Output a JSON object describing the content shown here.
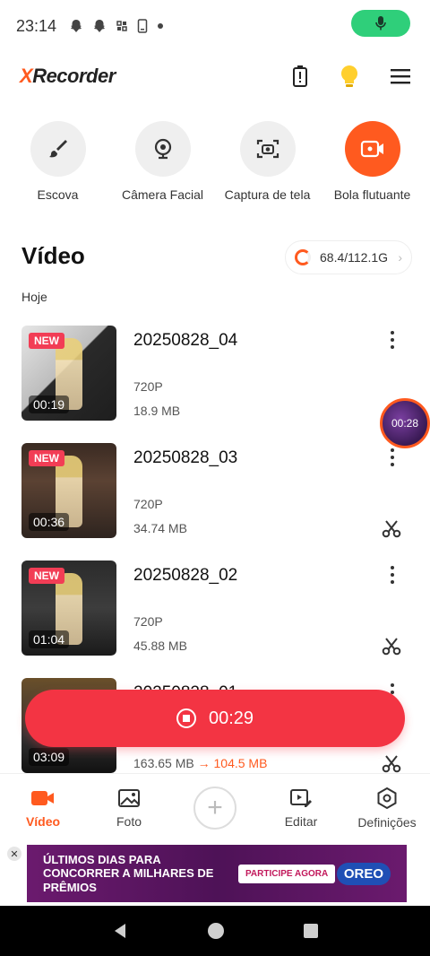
{
  "status_bar": {
    "time": "23:14"
  },
  "header": {
    "app_name_accent": "X",
    "app_name_rest": "Recorder"
  },
  "tools": [
    {
      "label": "Escova",
      "icon": "brush-icon"
    },
    {
      "label": "Câmera Facial",
      "icon": "webcam-icon"
    },
    {
      "label": "Captura de tela",
      "icon": "screenshot-icon"
    },
    {
      "label": "Bola flutuante",
      "icon": "float-video-icon"
    }
  ],
  "section": {
    "title": "Vídeo",
    "storage": "68.4/112.1G",
    "date_group": "Hoje"
  },
  "videos": [
    {
      "name": "20250828_04",
      "badge": "NEW",
      "duration": "00:19",
      "resolution": "720P",
      "size": "18.9 MB"
    },
    {
      "name": "20250828_03",
      "badge": "NEW",
      "duration": "00:36",
      "resolution": "720P",
      "size": "34.74 MB"
    },
    {
      "name": "20250828_02",
      "badge": "NEW",
      "duration": "01:04",
      "resolution": "720P",
      "size": "45.88 MB"
    },
    {
      "name": "20250828_01",
      "duration": "03:09",
      "size_original": "163.65 MB",
      "size_arrow": "→",
      "size_compressed": "104.5 MB"
    }
  ],
  "floating_ball": {
    "time": "00:28"
  },
  "record_button": {
    "elapsed": "00:29"
  },
  "bottom_nav": [
    {
      "label": "Vídeo",
      "icon": "video-icon",
      "active": true
    },
    {
      "label": "Foto",
      "icon": "photo-icon",
      "active": false
    },
    {
      "label": "+",
      "icon": "plus-icon"
    },
    {
      "label": "Editar",
      "icon": "edit-icon",
      "active": false
    },
    {
      "label": "Definições",
      "icon": "settings-icon",
      "active": false
    }
  ],
  "ad": {
    "close": "✕",
    "text": "ÚLTIMOS DIAS PARA CONCORRER A MILHARES DE PRÊMIOS",
    "cta": "PARTICIPE AGORA",
    "brand": "OREO"
  },
  "colors": {
    "accent": "#ff5a1f",
    "record": "#f33443",
    "mic_pill": "#2fcf7a"
  }
}
